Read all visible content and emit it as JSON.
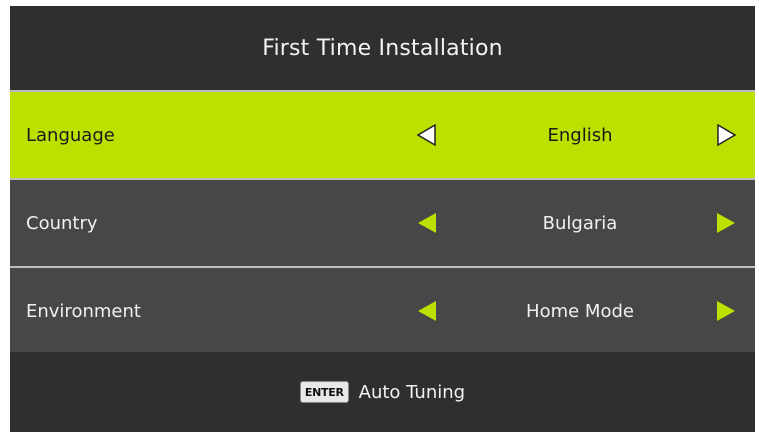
{
  "header": {
    "title": "First Time Installation"
  },
  "rows": [
    {
      "label": "Language",
      "value": "English",
      "selected": true
    },
    {
      "label": "Country",
      "value": "Bulgaria",
      "selected": false
    },
    {
      "label": "Environment",
      "value": "Home Mode",
      "selected": false
    }
  ],
  "footer": {
    "key_label": "ENTER",
    "action_label": "Auto Tuning"
  },
  "colors": {
    "accent": "#bde000",
    "panel_bg": "#2f2f2f",
    "row_bg": "#474747",
    "divider": "#bdbdbd",
    "arrow_active": "#bde000",
    "arrow_selected": "#ffffff"
  },
  "icons": {
    "left": "left-arrow-icon",
    "right": "right-arrow-icon",
    "enter": "enter-key-icon"
  }
}
